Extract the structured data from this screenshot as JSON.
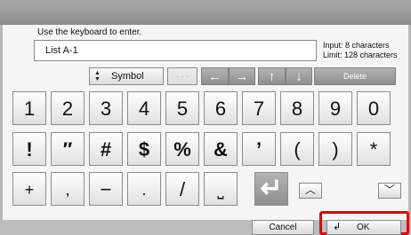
{
  "instruction": "Use the keyboard to enter.",
  "input": {
    "value": "List A-1"
  },
  "limits": {
    "input": "Input: 8 characters",
    "limit": "Limit: 128 characters"
  },
  "toolbar": {
    "symbol_label": "Symbol",
    "hyphens": "- - -",
    "left": "←",
    "right": "→",
    "up": "↑",
    "down": "↓",
    "delete_label": "Delete",
    "spin_up": "▲",
    "spin_down": "▼"
  },
  "keys": {
    "row1": [
      "1",
      "2",
      "3",
      "4",
      "5",
      "6",
      "7",
      "8",
      "9",
      "0"
    ],
    "row2": [
      "!",
      "″",
      "#",
      "$",
      "%",
      "&",
      "’",
      "(",
      ")",
      "*"
    ],
    "row3": [
      "+",
      ",",
      "−",
      ".",
      "/",
      "⎵"
    ]
  },
  "enter": "↵",
  "nav": {
    "up": "︿",
    "down": "﹀"
  },
  "buttons": {
    "cancel": "Cancel",
    "ok": "OK",
    "ok_icon": "↲"
  }
}
